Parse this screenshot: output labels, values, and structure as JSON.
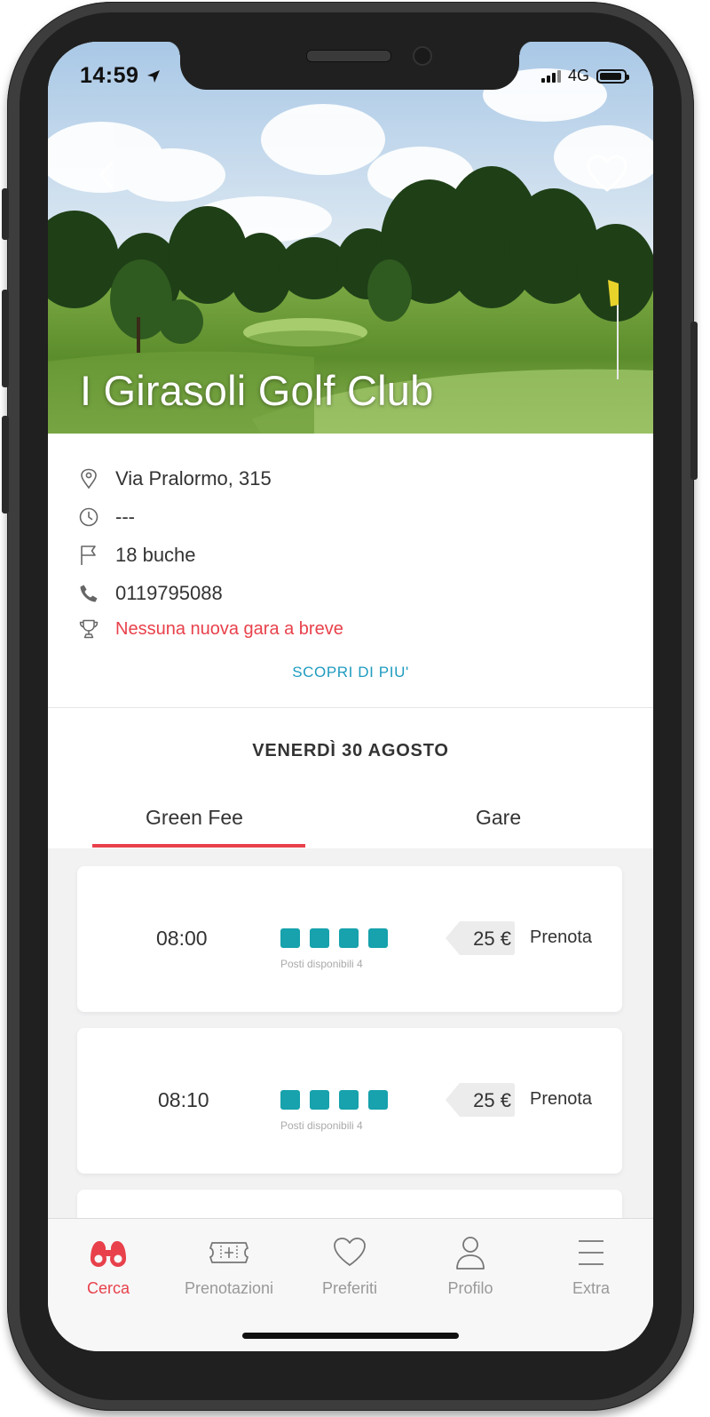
{
  "status_bar": {
    "time": "14:59",
    "network": "4G"
  },
  "club": {
    "name": "I Girasoli Golf Club"
  },
  "info": {
    "address": "Via Pralormo, 315",
    "hours": "---",
    "holes": "18 buche",
    "phone": "0119795088",
    "competitions": "Nessuna nuova gara a breve",
    "discover_label": "SCOPRI DI PIU'"
  },
  "date_label": "VENERDÌ 30 AGOSTO",
  "tabs": [
    {
      "label": "Green Fee",
      "active": true
    },
    {
      "label": "Gare",
      "active": false
    }
  ],
  "tee_times": [
    {
      "time": "08:00",
      "slots": 4,
      "slots_label": "Posti disponibili 4",
      "price": "25 €",
      "action": "Prenota"
    },
    {
      "time": "08:10",
      "slots": 4,
      "slots_label": "Posti disponibili 4",
      "price": "25 €",
      "action": "Prenota"
    }
  ],
  "tab_bar": [
    {
      "label": "Cerca",
      "icon": "binoculars-icon",
      "active": true
    },
    {
      "label": "Prenotazioni",
      "icon": "ticket-icon",
      "active": false
    },
    {
      "label": "Preferiti",
      "icon": "heart-icon",
      "active": false
    },
    {
      "label": "Profilo",
      "icon": "user-icon",
      "active": false
    },
    {
      "label": "Extra",
      "icon": "menu-icon",
      "active": false
    }
  ],
  "colors": {
    "accent_red": "#e8414b",
    "teal": "#17a2ad",
    "link_blue": "#1e9bbf"
  }
}
